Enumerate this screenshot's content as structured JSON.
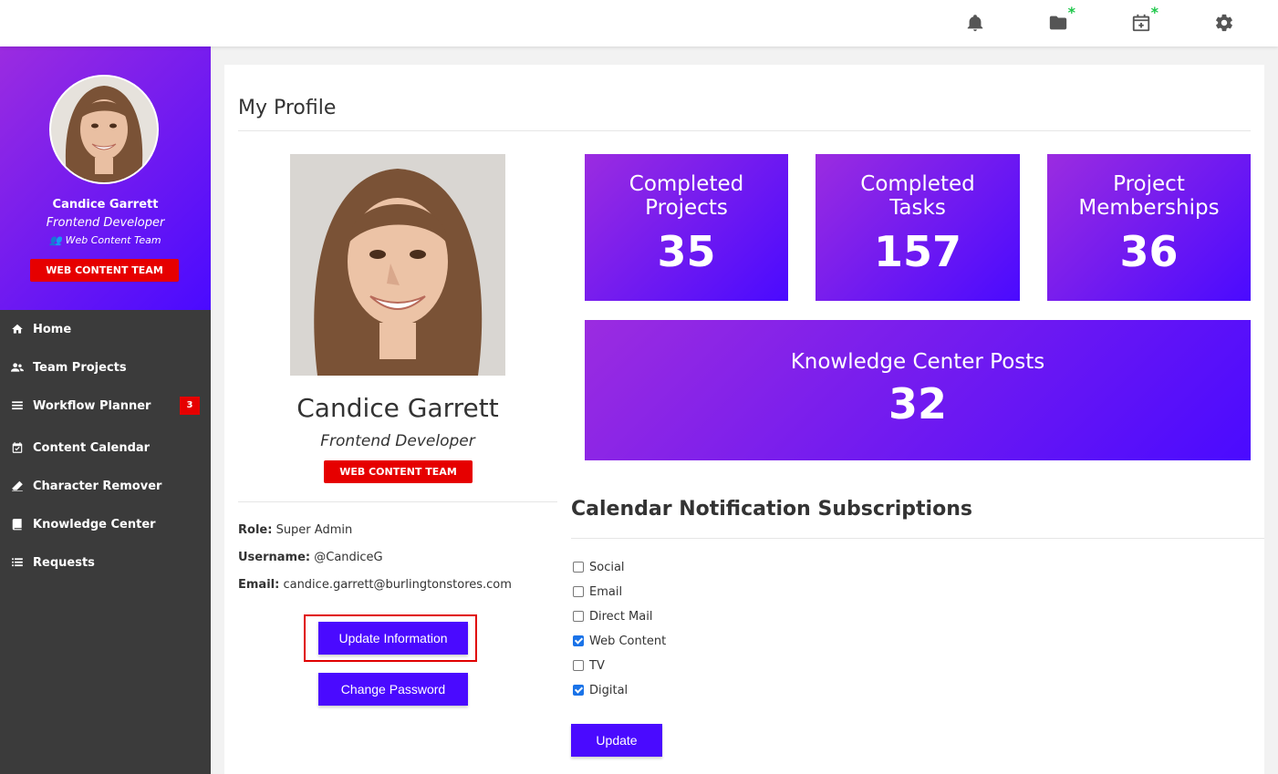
{
  "colors": {
    "accent": "#4a0aff",
    "gradient_start": "#9b2ce0",
    "badge_red": "#e60000",
    "sidebar_bg": "#3b3b3b",
    "new_green": "#1ec74a"
  },
  "topbar": {
    "icons": [
      "bell-icon",
      "folder-add-icon",
      "calendar-add-icon",
      "gear-icon"
    ]
  },
  "sidebar": {
    "name": "Candice Garrett",
    "role": "Frontend Developer",
    "team": "Web Content Team",
    "badge": "WEB CONTENT TEAM",
    "items": [
      {
        "label": "Home",
        "icon": "home-icon"
      },
      {
        "label": "Team Projects",
        "icon": "users-icon"
      },
      {
        "label": "Workflow Planner",
        "icon": "planner-icon",
        "badge": "3"
      },
      {
        "label": "Content Calendar",
        "icon": "calendar-icon"
      },
      {
        "label": "Character Remover",
        "icon": "eraser-icon"
      },
      {
        "label": "Knowledge Center",
        "icon": "book-icon"
      },
      {
        "label": "Requests",
        "icon": "list-icon"
      }
    ]
  },
  "profile": {
    "page_title": "My Profile",
    "name": "Candice Garrett",
    "role": "Frontend Developer",
    "badge": "WEB CONTENT TEAM",
    "role_label": "Role:",
    "role_value": "Super Admin",
    "username_label": "Username:",
    "username_value": "@CandiceG",
    "email_label": "Email:",
    "email_value": "candice.garrett@burlingtonstores.com",
    "update_info_label": "Update Information",
    "change_password_label": "Change Password"
  },
  "stats": {
    "completed_projects": {
      "line1": "Completed",
      "line2": "Projects",
      "value": "35"
    },
    "completed_tasks": {
      "line1": "Completed",
      "line2": "Tasks",
      "value": "157"
    },
    "project_memberships": {
      "line1": "Project",
      "line2": "Memberships",
      "value": "36"
    },
    "knowledge_posts": {
      "label": "Knowledge Center Posts",
      "value": "32"
    }
  },
  "subscriptions": {
    "title": "Calendar Notification Subscriptions",
    "options": [
      {
        "label": "Social",
        "checked": false
      },
      {
        "label": "Email",
        "checked": false
      },
      {
        "label": "Direct Mail",
        "checked": false
      },
      {
        "label": "Web Content",
        "checked": true
      },
      {
        "label": "TV",
        "checked": false
      },
      {
        "label": "Digital",
        "checked": true
      }
    ],
    "update_label": "Update"
  }
}
